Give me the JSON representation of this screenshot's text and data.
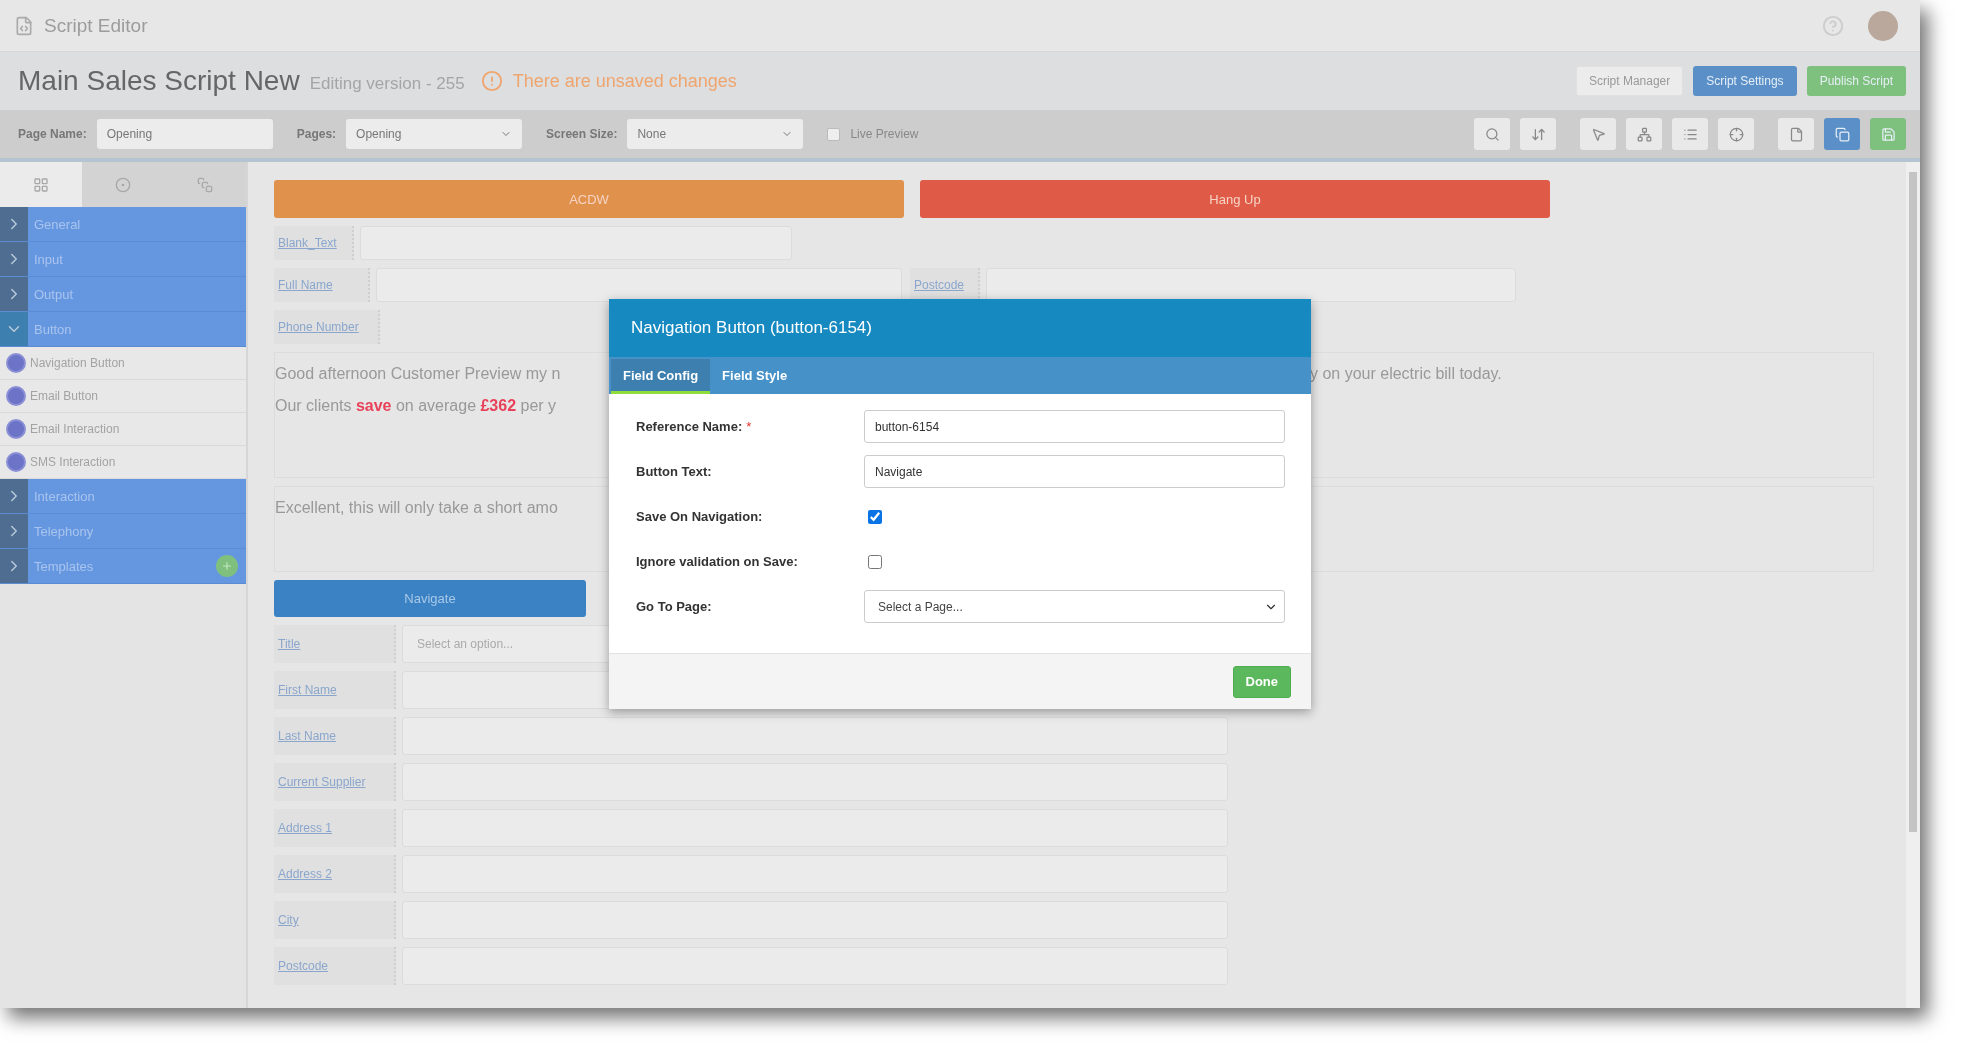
{
  "app_bar": {
    "title": "Script Editor"
  },
  "script_header": {
    "title": "Main Sales Script New",
    "version": "Editing version - 255",
    "warning": "There are unsaved changes",
    "buttons": [
      {
        "label": "Script Manager",
        "kind": "default"
      },
      {
        "label": "Script Settings",
        "kind": "primary"
      },
      {
        "label": "Publish Script",
        "kind": "success"
      }
    ]
  },
  "toolbar": {
    "page_name": {
      "label": "Page Name:",
      "value": "Opening"
    },
    "pages": {
      "label": "Pages:",
      "value": "Opening"
    },
    "screen_size": {
      "label": "Screen Size:",
      "value": "None"
    },
    "live_preview": {
      "label": "Live Preview",
      "checked": false
    },
    "tools": [
      {
        "kind": "default"
      },
      {
        "kind": "default"
      },
      {
        "kind": "default"
      },
      {
        "kind": "default"
      },
      {
        "kind": "default"
      },
      {
        "kind": "default"
      },
      {
        "kind": "default"
      },
      {
        "kind": "primary"
      },
      {
        "kind": "success"
      }
    ]
  },
  "sidebar": {
    "tabs": [
      {
        "selected": true
      },
      {
        "selected": false
      },
      {
        "selected": false
      }
    ],
    "items": [
      {
        "label": "General",
        "expanded": false
      },
      {
        "label": "Input",
        "expanded": false
      },
      {
        "label": "Output",
        "expanded": false
      },
      {
        "label": "Button",
        "expanded": true,
        "children": [
          {
            "label": "Navigation Button"
          },
          {
            "label": "Email Button"
          },
          {
            "label": "Email Interaction"
          },
          {
            "label": "SMS Interaction"
          }
        ]
      },
      {
        "label": "Interaction",
        "expanded": false
      },
      {
        "label": "Telephony",
        "expanded": false
      },
      {
        "label": "Templates",
        "expanded": false,
        "badge": true
      }
    ]
  },
  "canvas": {
    "action_buttons": [
      {
        "label": "ACDW",
        "color": "#e0914c"
      },
      {
        "label": "Hang Up",
        "color": "#e05a48"
      }
    ],
    "top_fields": [
      {
        "label": "Blank_Text"
      },
      {
        "label": "Full Name"
      },
      {
        "label": "Phone Number"
      }
    ],
    "side_field": {
      "label": "Postcode"
    },
    "script_text": {
      "line_1_start": "Good afternoon Customer Preview my n",
      "line_1_end": "y on your electric bill today.",
      "line_2_start": "Our clients **save** on average **£362** per y"
    },
    "script_text_2": "Excellent, this will only take a short amo",
    "navigate_button": "Navigate",
    "fields": [
      {
        "label": "Title",
        "kind": "select",
        "placeholder": "Select an option..."
      },
      {
        "label": "First Name",
        "kind": "text"
      },
      {
        "label": "Last Name",
        "kind": "text"
      },
      {
        "label": "Current Supplier",
        "kind": "text"
      },
      {
        "label": "Address 1",
        "kind": "text"
      },
      {
        "label": "Address 2",
        "kind": "text"
      },
      {
        "label": "City",
        "kind": "text"
      },
      {
        "label": "Postcode",
        "kind": "text"
      }
    ]
  },
  "dialog": {
    "title": "Navigation Button (button-6154)",
    "tabs": [
      {
        "label": "Field Config",
        "selected": true
      },
      {
        "label": "Field Style",
        "selected": false
      }
    ],
    "rows": [
      {
        "label": "Reference Name:",
        "required_mark": "*",
        "kind": "text",
        "value": "button-6154"
      },
      {
        "label": "Button Text:",
        "kind": "text",
        "value": "Navigate"
      },
      {
        "label": "Save On Navigation:",
        "kind": "checkbox",
        "checked": true
      },
      {
        "label": "Ignore validation on Save:",
        "kind": "checkbox",
        "checked": false
      },
      {
        "label": "Go To Page:",
        "kind": "select",
        "value": "Select a Page..."
      }
    ],
    "done": "Done"
  }
}
